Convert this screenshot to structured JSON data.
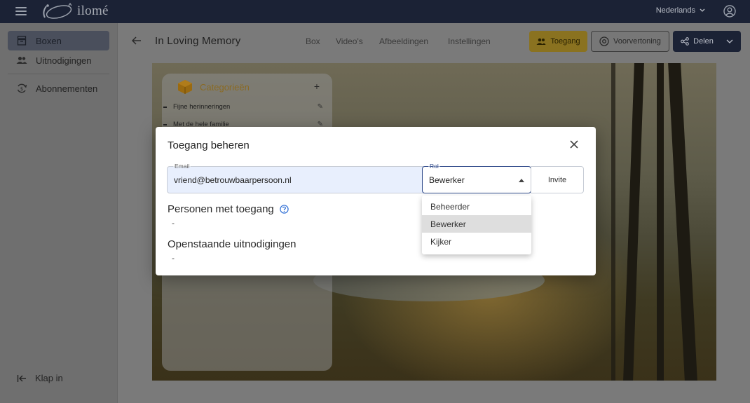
{
  "topbar": {
    "logo_text": "ilomé",
    "language": "Nederlands",
    "icons": {
      "menu": "hamburger-icon",
      "account": "account-icon",
      "chevron": "chevron-down-icon"
    }
  },
  "sidebar": {
    "items": [
      {
        "label": "Boxen",
        "icon": "box-icon",
        "active": true
      },
      {
        "label": "Uitnodigingen",
        "icon": "people-icon",
        "active": false
      },
      {
        "label": "Abonnementen",
        "icon": "subscription-icon",
        "active": false
      }
    ],
    "collapse_label": "Klap in"
  },
  "header": {
    "title": "In Loving Memory",
    "tabs": [
      "Box",
      "Video's",
      "Afbeeldingen",
      "Instellingen"
    ],
    "buttons": {
      "access": "Toegang",
      "preview": "Voorvertoning",
      "share": "Delen"
    }
  },
  "categories": {
    "title": "Categorieën",
    "items": [
      "Fijne herinneringen",
      "Met de hele familie"
    ]
  },
  "dialog": {
    "title": "Toegang beheren",
    "email": {
      "label": "Email",
      "value": "vriend@betrouwbaarpersoon.nl"
    },
    "role": {
      "label": "Rol",
      "value": "Bewerker",
      "options": [
        "Beheerder",
        "Bewerker",
        "Kijker"
      ],
      "selected_index": 1
    },
    "invite_label": "Invite",
    "people_with_access": {
      "title": "Personen met toegang",
      "value": "-"
    },
    "pending_invites": {
      "title": "Openstaande uitnodigingen",
      "value": "-"
    }
  },
  "colors": {
    "topbar": "#1b2235",
    "accent_gold": "#d4a62a",
    "focus_blue": "#2f4a8a",
    "help_blue": "#2f6fd6",
    "autofill_blue": "#e8effd"
  }
}
